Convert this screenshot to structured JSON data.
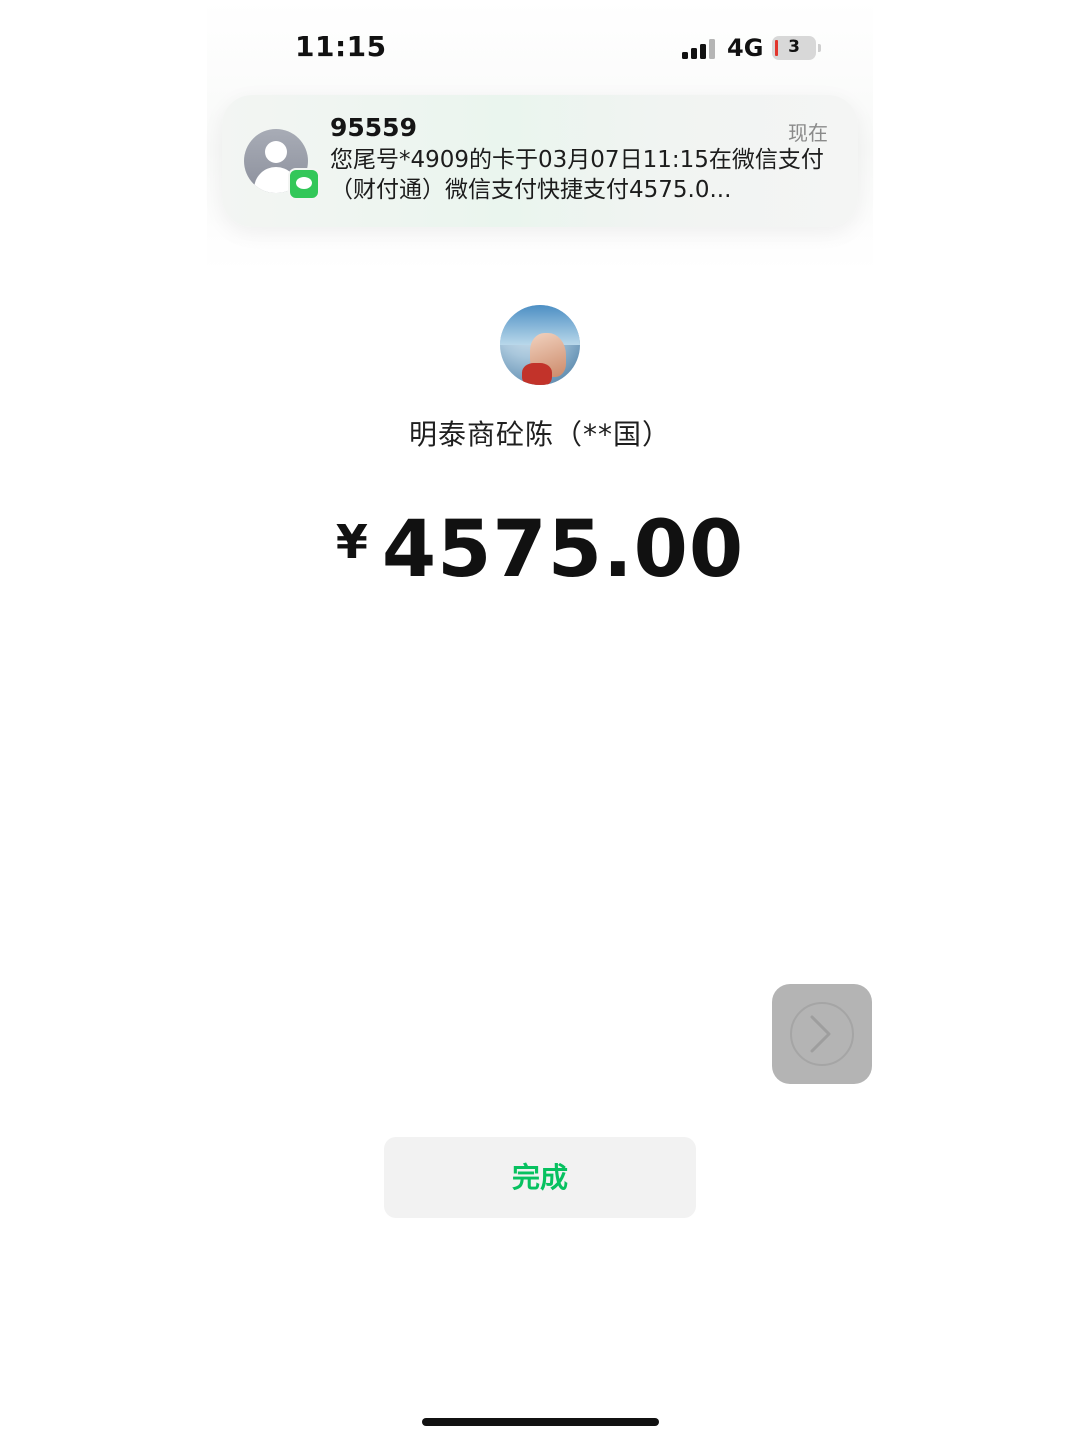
{
  "status_bar": {
    "time": "11:15",
    "network": "4G",
    "battery_level": "3",
    "signal_bars_active": 3,
    "signal_bars_total": 4
  },
  "notification": {
    "sender": "95559",
    "time": "现在",
    "body": "您尾号*4909的卡于03月07日11:15在微信支付（财付通）微信支付快捷支付4575.0...",
    "app_icon": "messages-icon",
    "avatar_icon": "person-icon"
  },
  "payment": {
    "merchant_name": "明泰商砼陈（**国）",
    "currency_symbol": "¥",
    "amount": "4575.00"
  },
  "actions": {
    "done_label": "完成",
    "floating_button_icon": "chevron-right-icon"
  },
  "colors": {
    "accent_green": "#07c160",
    "battery_low": "#e2352c",
    "messages_green": "#33c759"
  }
}
